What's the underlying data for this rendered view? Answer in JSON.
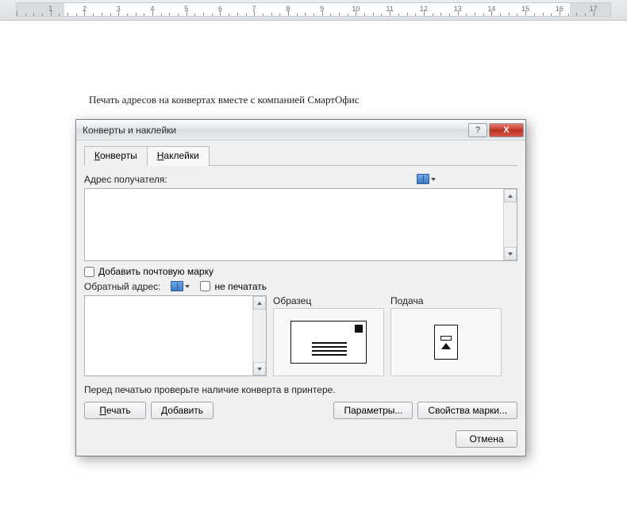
{
  "ruler": {
    "min": 1,
    "max": 17,
    "left_margin_end": 1.4,
    "right_margin_start": 16.3
  },
  "document": {
    "visible_text": "Печать адресов на конвертах вместе с компанией СмартОфис"
  },
  "dialog": {
    "title": "Конверты и наклейки",
    "help_tooltip": "?",
    "close_tooltip": "X",
    "tabs": {
      "envelopes": {
        "label": "Конверты",
        "underline_index": 0
      },
      "labels": {
        "label": "Наклейки",
        "underline_index": 0
      },
      "active": "envelopes"
    },
    "recipient": {
      "label": "Адрес получателя:",
      "value": ""
    },
    "add_postage": {
      "label": "Добавить почтовую марку",
      "checked": false
    },
    "return_address": {
      "label": "Обратный адрес:",
      "omit_label": "не печатать",
      "omit_checked": false,
      "value": ""
    },
    "sample": {
      "label": "Образец"
    },
    "feed": {
      "label": "Подача"
    },
    "instruction": "Перед печатью проверьте наличие конверта в принтере.",
    "buttons": {
      "print": "Печать",
      "add": "Добавить",
      "options": "Параметры...",
      "postage_props": "Свойства марки...",
      "cancel": "Отмена"
    }
  }
}
